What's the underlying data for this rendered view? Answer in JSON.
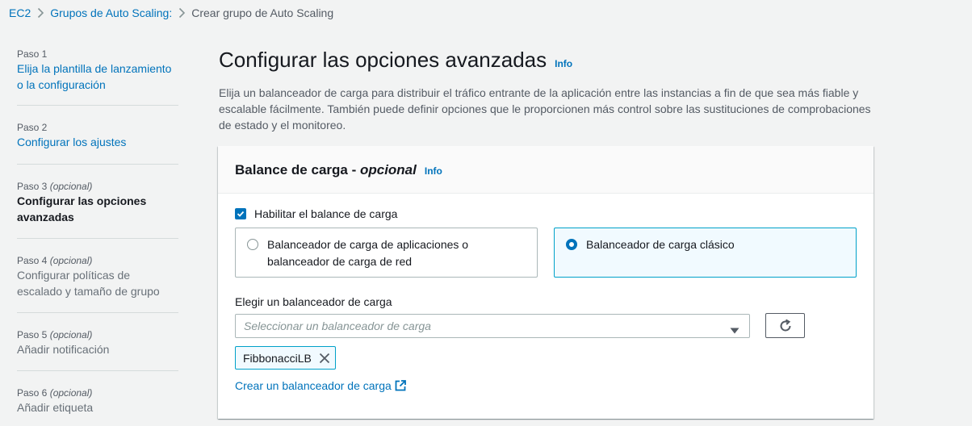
{
  "breadcrumb": {
    "items": [
      "EC2",
      "Grupos de Auto Scaling:",
      "Crear grupo de Auto Scaling"
    ]
  },
  "steps": [
    {
      "label": "Paso 1",
      "optional": "",
      "title_lines": [
        "Elija la plantilla de lanzamiento",
        "o la configuración"
      ],
      "state": "link"
    },
    {
      "label": "Paso 2",
      "optional": "",
      "title_lines": [
        "Configurar los ajustes"
      ],
      "state": "link"
    },
    {
      "label": "Paso 3",
      "optional": "(opcional)",
      "title_lines": [
        "Configurar las opciones",
        "avanzadas"
      ],
      "state": "current"
    },
    {
      "label": "Paso 4",
      "optional": "(opcional)",
      "title_lines": [
        "Configurar políticas de",
        "escalado y tamaño de grupo"
      ],
      "state": "disabled"
    },
    {
      "label": "Paso 5",
      "optional": "(opcional)",
      "title_lines": [
        "Añadir notificación"
      ],
      "state": "disabled"
    },
    {
      "label": "Paso 6",
      "optional": "(opcional)",
      "title_lines": [
        "Añadir etiqueta"
      ],
      "state": "disabled"
    }
  ],
  "main": {
    "title": "Configurar las opciones avanzadas",
    "info": "Info",
    "description": "Elija un balanceador de carga para distribuir el tráfico entrante de la aplicación entre las instancias a fin de que sea más fiable y escalable fácilmente. También puede definir opciones que le proporcionen más control sobre las sustituciones de comprobaciones de estado y el monitoreo."
  },
  "panel": {
    "title": "Balance de carga - ",
    "title_optional": "opcional",
    "info": "Info",
    "checkbox_label": "Habilitar el balance de carga",
    "checkbox_checked": true,
    "tiles": [
      {
        "label": "Balanceador de carga de aplicaciones o balanceador de carga de red",
        "selected": false
      },
      {
        "label": "Balanceador de carga clásico",
        "selected": true
      }
    ],
    "select_label": "Elegir un balanceador de carga",
    "select_placeholder": "Seleccionar un balanceador de carga",
    "token": "FibbonacciLB",
    "create_link": "Crear un balanceador de carga"
  },
  "colors": {
    "link": "#0073bb",
    "selected_bg": "#f1faff",
    "selected_border": "#00a1c9",
    "background": "#f2f3f3"
  }
}
